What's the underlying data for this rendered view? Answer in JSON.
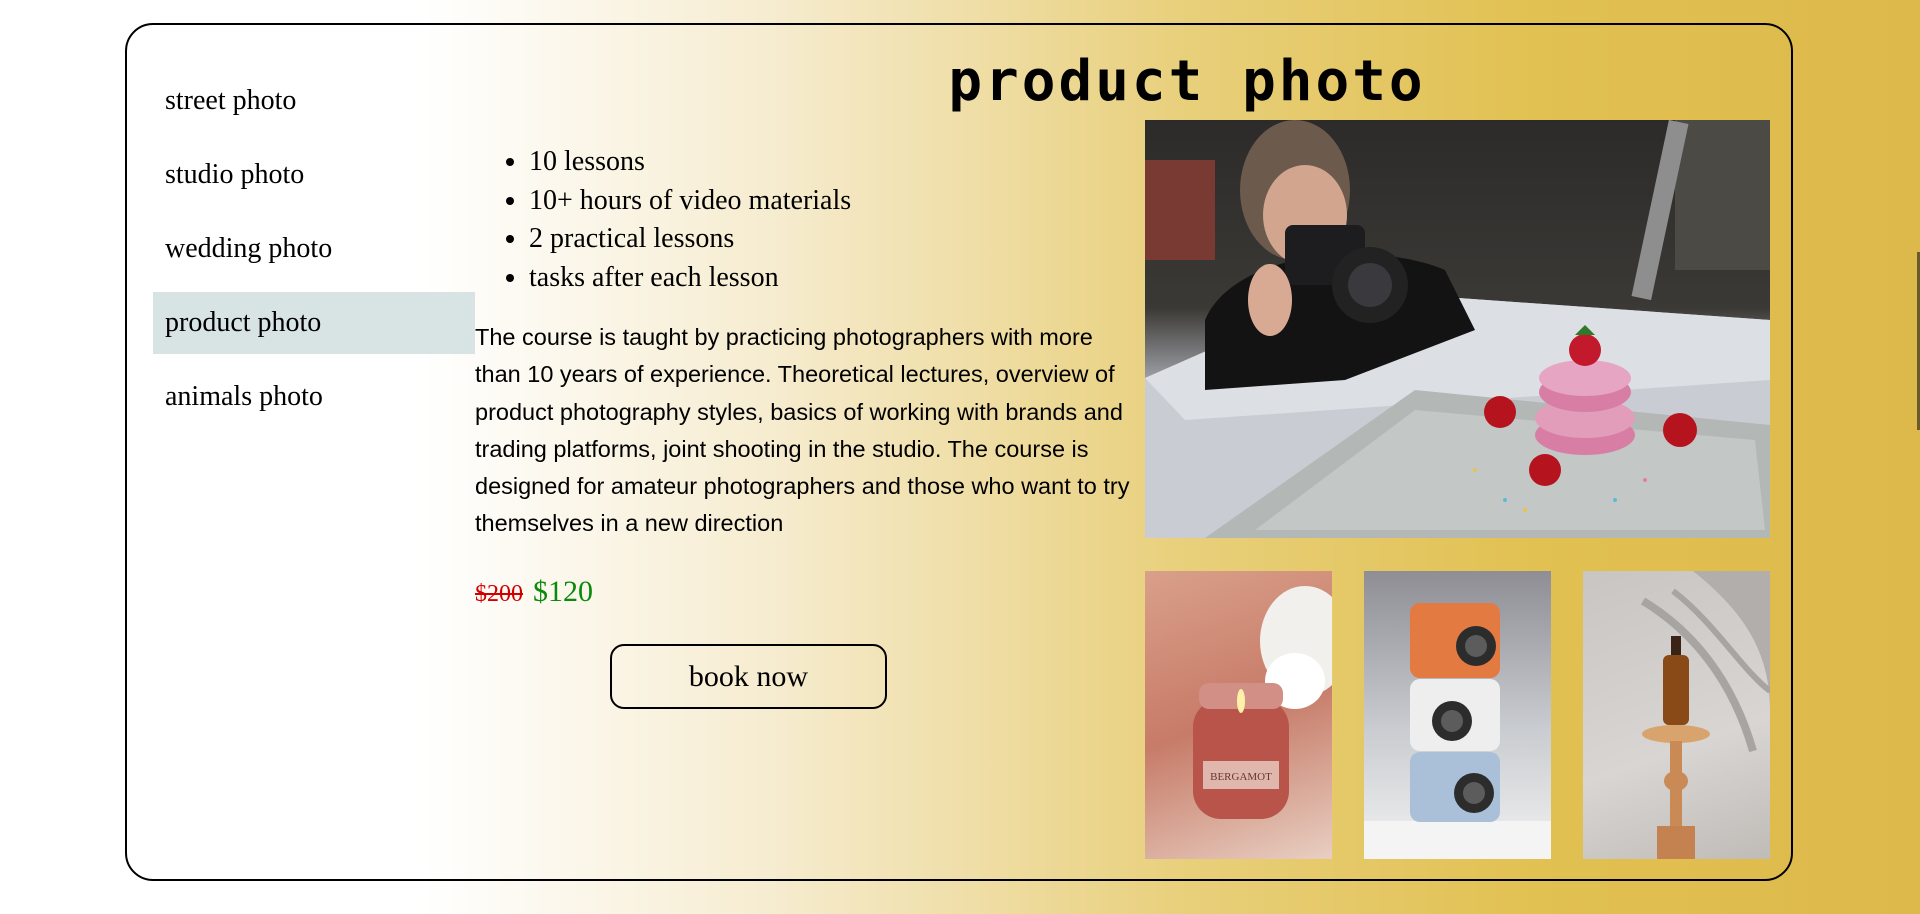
{
  "sidebar": {
    "items": [
      {
        "label": "street photo"
      },
      {
        "label": "studio photo"
      },
      {
        "label": "wedding photo"
      },
      {
        "label": "product photo",
        "active": true
      },
      {
        "label": "animals photo"
      }
    ]
  },
  "main": {
    "title": "product photo",
    "features": [
      "10 lessons",
      "10+ hours of video materials",
      "2 practical lessons",
      "tasks after each lesson"
    ],
    "description": "The course is taught by practicing photographers with more than 10 years of experience. Theoretical lectures, overview of product photography styles, basics of working with brands and trading platforms, joint shooting in the studio. The course is designed for amateur photographers and those who want to try themselves in a new direction",
    "old_price": "$200",
    "new_price": "$120",
    "book_label": "book now"
  },
  "images": {
    "main": "photographer-shooting-donut-photo",
    "thumb1": "candle-jar-photo",
    "thumb2": "instant-cameras-photo",
    "thumb3": "dropper-bottle-photo"
  },
  "colors": {
    "active_item_bg": "#d8e3e4",
    "old_price": "#d00000",
    "new_price": "#0a8a0a",
    "gradient_gold": "#ddb84a"
  }
}
